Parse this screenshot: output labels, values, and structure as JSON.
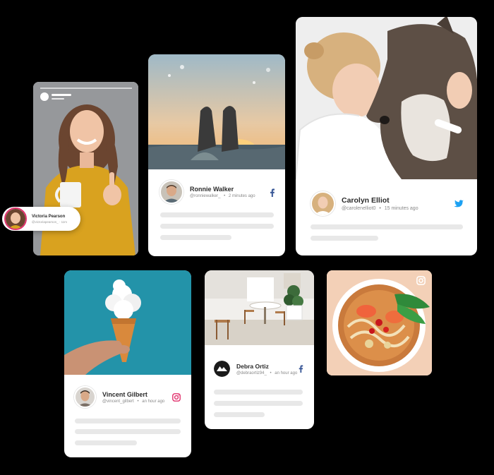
{
  "cards": {
    "victoria": {
      "name": "Victoria Pearson",
      "sub": "@victoriapearson_ · 11m"
    },
    "ronnie": {
      "name": "Ronnie Walker",
      "handle": "@ronniewalker_",
      "time": "2 minutes ago",
      "network": "facebook-icon"
    },
    "carolyn": {
      "name": "Carolyn Elliot",
      "handle": "@carolenelliot0",
      "time": "15 minutes ago",
      "network": "twitter-icon"
    },
    "vincent": {
      "name": "Vincent Gilbert",
      "handle": "@vincent_gilbert",
      "time": "an hour ago",
      "network": "instagram-icon"
    },
    "debra": {
      "name": "Debra Ortiz",
      "handle": "@debraortiz94_",
      "time": "an hour ago",
      "network": "facebook-icon"
    },
    "food": {
      "network": "instagram-icon"
    }
  },
  "separator": "•",
  "colors": {
    "background": "#000000",
    "card": "#ffffff",
    "placeholder": "#e8e8e8",
    "facebook": "#3b5998",
    "twitter": "#1da1f2",
    "instagram": "#e1306c"
  }
}
